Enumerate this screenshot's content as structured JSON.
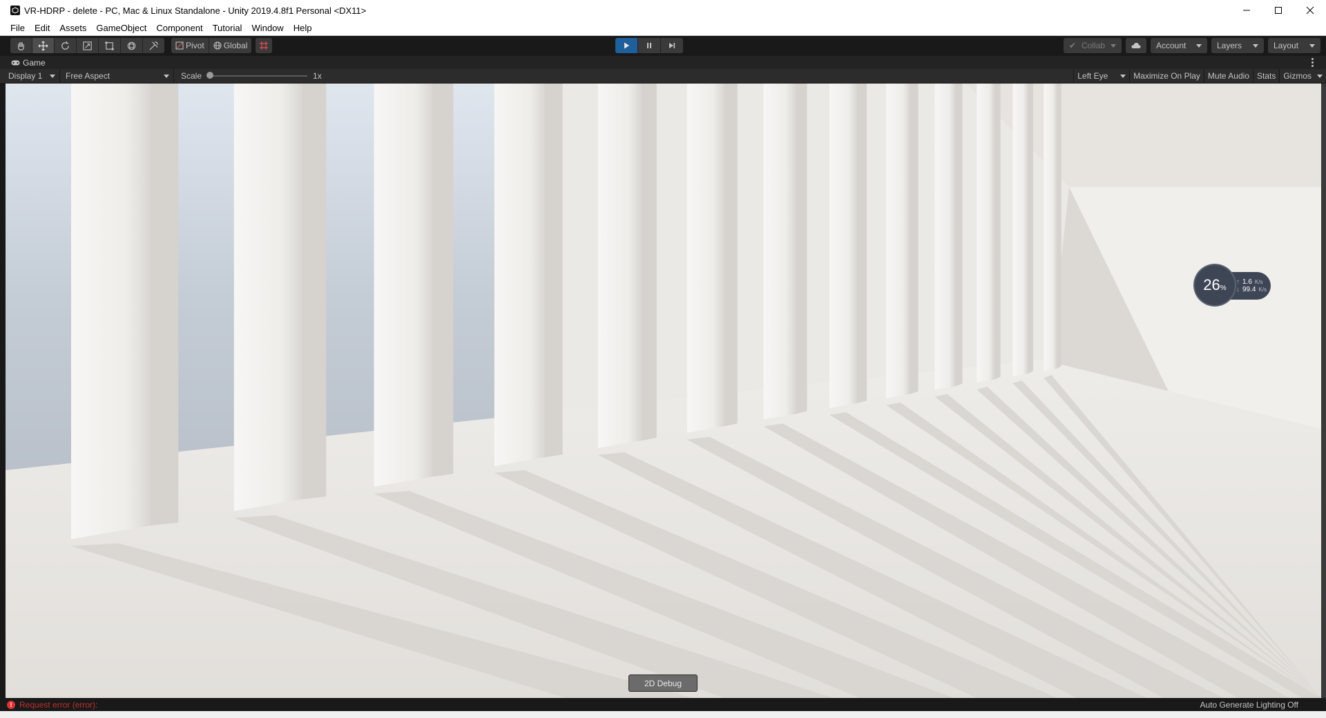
{
  "window": {
    "title": "VR-HDRP - delete - PC, Mac & Linux Standalone - Unity 2019.4.8f1 Personal <DX11>"
  },
  "menu": [
    "File",
    "Edit",
    "Assets",
    "GameObject",
    "Component",
    "Tutorial",
    "Window",
    "Help"
  ],
  "toolbar": {
    "tools": [
      "hand-icon",
      "move-icon",
      "rotate-icon",
      "scale-icon",
      "rect-icon",
      "transform-icon",
      "custom-tool-icon"
    ],
    "active_tool": "move-icon",
    "pivot_label": "Pivot",
    "global_label": "Global",
    "play_active": true,
    "collab_label": "Collab",
    "account_label": "Account",
    "layers_label": "Layers",
    "layout_label": "Layout"
  },
  "game_tab": {
    "label": "Game"
  },
  "game_bar": {
    "display": "Display 1",
    "aspect": "Free Aspect",
    "scale_label": "Scale",
    "scale_value": "1x",
    "eye": "Left Eye",
    "maximize": "Maximize On Play",
    "mute": "Mute Audio",
    "stats": "Stats",
    "gizmos": "Gizmos"
  },
  "perf_widget": {
    "percent": "26",
    "percent_unit": "%",
    "upload": "1.6",
    "download": "99.4",
    "rate_unit": "K/s"
  },
  "debug_button": "2D Debug",
  "status": {
    "error": "Request error (error):",
    "right": "Auto Generate Lighting Off"
  },
  "colors": {
    "play_active": "#1f5f9c",
    "error_red": "#c2302e"
  }
}
